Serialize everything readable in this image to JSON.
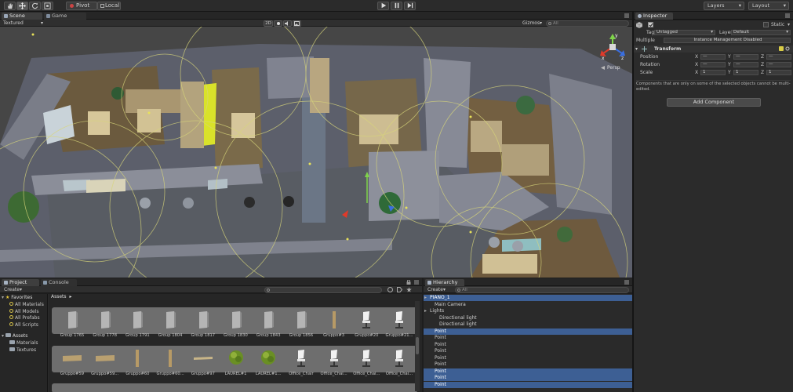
{
  "toolbar": {
    "tools": [
      "hand-icon",
      "move-icon",
      "rotate-icon",
      "scale-icon"
    ],
    "pivot_label": "Pivot",
    "local_label": "Local",
    "play_icon": "play-icon",
    "pause_icon": "pause-icon",
    "step_icon": "step-icon",
    "layers_label": "Layers",
    "layout_label": "Layout"
  },
  "scene_tabs": {
    "scene": "Scene",
    "game": "Game"
  },
  "scene_bar": {
    "render_mode": "Textured",
    "mode_2d": "2D",
    "gizmos": "Gizmos",
    "search_placeholder": "All"
  },
  "scene_view": {
    "persp_label": "Persp",
    "gizmo_axes": {
      "y": "y",
      "x": "x",
      "z": "z"
    }
  },
  "inspector": {
    "tab": "Inspector",
    "static_label": "Static",
    "tag_label": "Tag",
    "tag_value": "Untagged",
    "layer_label": "Layer",
    "layer_value": "Default",
    "multiple_label": "Multiple",
    "multiple_value": "Instance Management Disabled",
    "transform_title": "Transform",
    "rows": [
      {
        "label": "Position",
        "x": "—",
        "y": "—",
        "z": "—"
      },
      {
        "label": "Rotation",
        "x": "—",
        "y": "—",
        "z": "—"
      },
      {
        "label": "Scale",
        "x": "1",
        "y": "1",
        "z": "1"
      }
    ],
    "axis_x": "X",
    "axis_y": "Y",
    "axis_z": "Z",
    "note": "Components that are only on some of the selected objects cannot be multi-edited.",
    "add_component": "Add Component"
  },
  "project": {
    "tabs": [
      "Project",
      "Console"
    ],
    "create": "Create",
    "favorites": "Favorites",
    "favorite_items": [
      "All Materials",
      "All Models",
      "All Prefabs",
      "All Scripts"
    ],
    "assets": "Assets",
    "asset_folders": [
      "Materials",
      "Textures"
    ],
    "breadcrumb": "Assets",
    "search_placeholder": "",
    "row1": [
      "Group 1765",
      "Group 1778",
      "Group 1791",
      "Group 1804",
      "Group 1817",
      "Group 1830",
      "Group 1843",
      "Group 1856",
      "Gruppo#3",
      "Gruppo#20",
      "Gruppo#21..."
    ],
    "row2": [
      "Gruppo#59",
      "Gruppo#59...",
      "Gruppo#60",
      "Gruppo#60...",
      "Gruppo#97",
      "LAUREL#1",
      "LAUREL#1...",
      "Office_Chair",
      "Office_Chai...",
      "Office_Chai...",
      "Office_Chai..."
    ]
  },
  "hierarchy": {
    "tab": "Hierarchy",
    "create": "Create",
    "search_placeholder": "All",
    "items": [
      {
        "label": "PIANO_1",
        "indent": 0,
        "selected": true,
        "arrow": true
      },
      {
        "label": "Main Camera",
        "indent": 1,
        "selected": false,
        "arrow": false
      },
      {
        "label": "Lights",
        "indent": 0,
        "selected": false,
        "arrow": true
      },
      {
        "label": "Directional light",
        "indent": 2,
        "selected": false,
        "arrow": false
      },
      {
        "label": "Directional light",
        "indent": 2,
        "selected": false,
        "arrow": false
      },
      {
        "label": "Point",
        "indent": 1,
        "selected": true,
        "arrow": false
      },
      {
        "label": "Point",
        "indent": 1,
        "selected": false,
        "arrow": false
      },
      {
        "label": "Point",
        "indent": 1,
        "selected": false,
        "arrow": false
      },
      {
        "label": "Point",
        "indent": 1,
        "selected": false,
        "arrow": false
      },
      {
        "label": "Point",
        "indent": 1,
        "selected": false,
        "arrow": false
      },
      {
        "label": "Point",
        "indent": 1,
        "selected": false,
        "arrow": false
      },
      {
        "label": "Point",
        "indent": 1,
        "selected": true,
        "arrow": false
      },
      {
        "label": "Point",
        "indent": 1,
        "selected": true,
        "arrow": false
      },
      {
        "label": "Point",
        "indent": 1,
        "selected": true,
        "arrow": false
      }
    ]
  },
  "colors": {
    "selection": "#3d5f94",
    "scene_bg": "#454545",
    "gizmo_x": "#e03a2a",
    "gizmo_y": "#7fd34a",
    "gizmo_z": "#3a6fe0",
    "light_gizmo": "#d8d67a"
  }
}
